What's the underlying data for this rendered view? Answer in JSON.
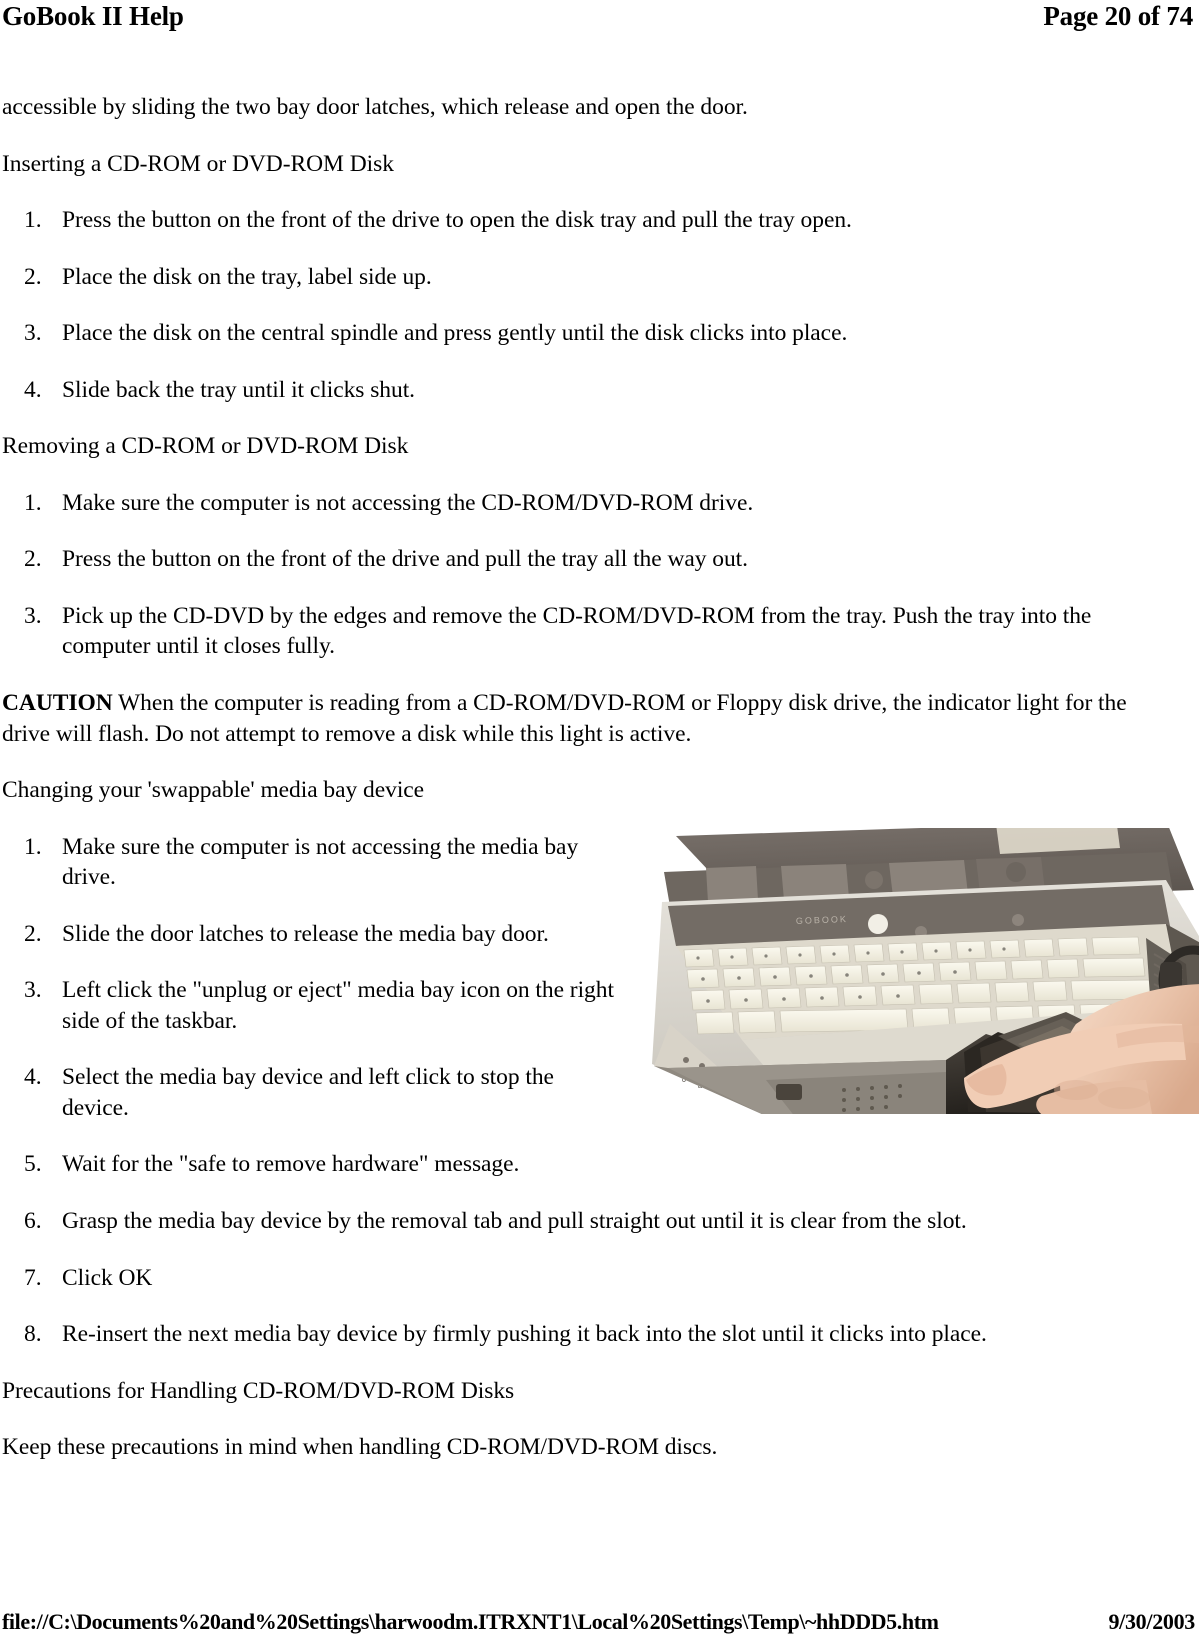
{
  "header": {
    "title": "GoBook II Help",
    "page_label": "Page 20 of 74"
  },
  "body": {
    "intro_paragraph": "accessible by sliding the two bay door latches, which  release and open the door.",
    "section_inserting": {
      "heading": "Inserting a CD-ROM or DVD-ROM Disk",
      "steps": [
        "Press the button on the front of the drive to open the disk tray and pull the tray open.",
        "Place the disk on the tray, label side up.",
        "Place the disk on the central spindle and press gently until the disk clicks into place.",
        "Slide back the tray until it clicks shut."
      ]
    },
    "section_removing": {
      "heading": "Removing a CD-ROM or DVD-ROM Disk",
      "steps": [
        "Make sure the computer is not accessing the CD-ROM/DVD-ROM drive.",
        "Press the button on the front of the drive and pull the tray all the way out.",
        "Pick up the CD-DVD by the edges and remove the CD-ROM/DVD-ROM from the tray.  Push the tray into the computer until it closes fully."
      ]
    },
    "caution": {
      "label": "CAUTION",
      "text": " When the computer is reading from a CD-ROM/DVD-ROM or Floppy disk drive, the indicator light for the drive will flash.  Do not attempt to remove a disk while this light is active."
    },
    "section_swappable": {
      "heading": "Changing your 'swappable' media bay device",
      "steps": [
        "Make sure the computer is not accessing the media bay drive.",
        "Slide the door latches to release the media bay door.",
        "Left click the \"unplug or eject\" media bay icon on the right side of the taskbar.",
        "Select the media bay device and left click to stop the device.",
        "Wait for the \"safe to remove hardware\" message.",
        "Grasp the media bay device by the removal tab and pull straight out until it is clear from the slot.",
        "Click OK",
        "Re-insert the next media bay device by firmly pushing it back into the slot until it clicks into place."
      ]
    },
    "section_precautions": {
      "heading": "Precautions for Handling CD-ROM/DVD-ROM Disks",
      "intro": "Keep these precautions in mind when handling CD-ROM/DVD-ROM discs."
    }
  },
  "figure": {
    "alt": "Photograph of a rugged GoBook II notebook computer, open, with a person's hand pulling the swappable media bay device out of the right-hand slot"
  },
  "footer": {
    "file_path": "file://C:\\Documents%20and%20Settings\\harwoodm.ITRXNT1\\Local%20Settings\\Temp\\~hhDDD5.htm",
    "date": "9/30/2003"
  }
}
